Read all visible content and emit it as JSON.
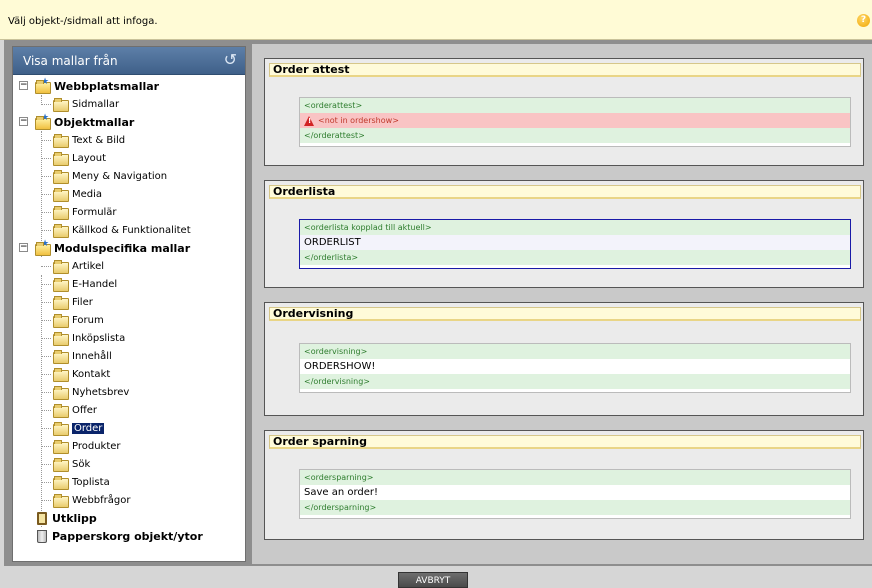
{
  "header": {
    "message": "Välj objekt-/sidmall att infoga."
  },
  "sidebar": {
    "title": "Visa mallar från",
    "items": [
      "Webbplatsmallar",
      "Sidmallar",
      "Objektmallar",
      "Text & Bild",
      "Layout",
      "Meny & Navigation",
      "Media",
      "Formulär",
      "Källkod & Funktionalitet",
      "Modulspecifika mallar",
      "Artikel",
      "E-Handel",
      "Filer",
      "Forum",
      "Inköpslista",
      "Innehåll",
      "Kontakt",
      "Nyhetsbrev",
      "Offer",
      "Order",
      "Produkter",
      "Sök",
      "Toplista",
      "Webbfrågor",
      "Utklipp",
      "Papperskorg objekt/ytor"
    ],
    "selected": "Order"
  },
  "templates": [
    {
      "title": "Order attest",
      "open_tag": "<orderattest>",
      "error": "<not in ordershow>",
      "close_tag": "</orderattest>"
    },
    {
      "title": "Orderlista",
      "open_tag": "<orderlista kopplad till aktuell>",
      "body": "ORDERLIST",
      "close_tag": "</orderlista>"
    },
    {
      "title": "Ordervisning",
      "open_tag": "<ordervisning>",
      "body": "ORDERSHOW!",
      "close_tag": "</ordervisning>"
    },
    {
      "title": "Order sparning",
      "open_tag": "<ordersparning>",
      "body": "Save an order!",
      "close_tag": "</ordersparning>"
    }
  ],
  "footer": {
    "cancel_label": "AVBRYT"
  },
  "icons": {
    "help": "question-icon",
    "refresh": "refresh-icon"
  }
}
